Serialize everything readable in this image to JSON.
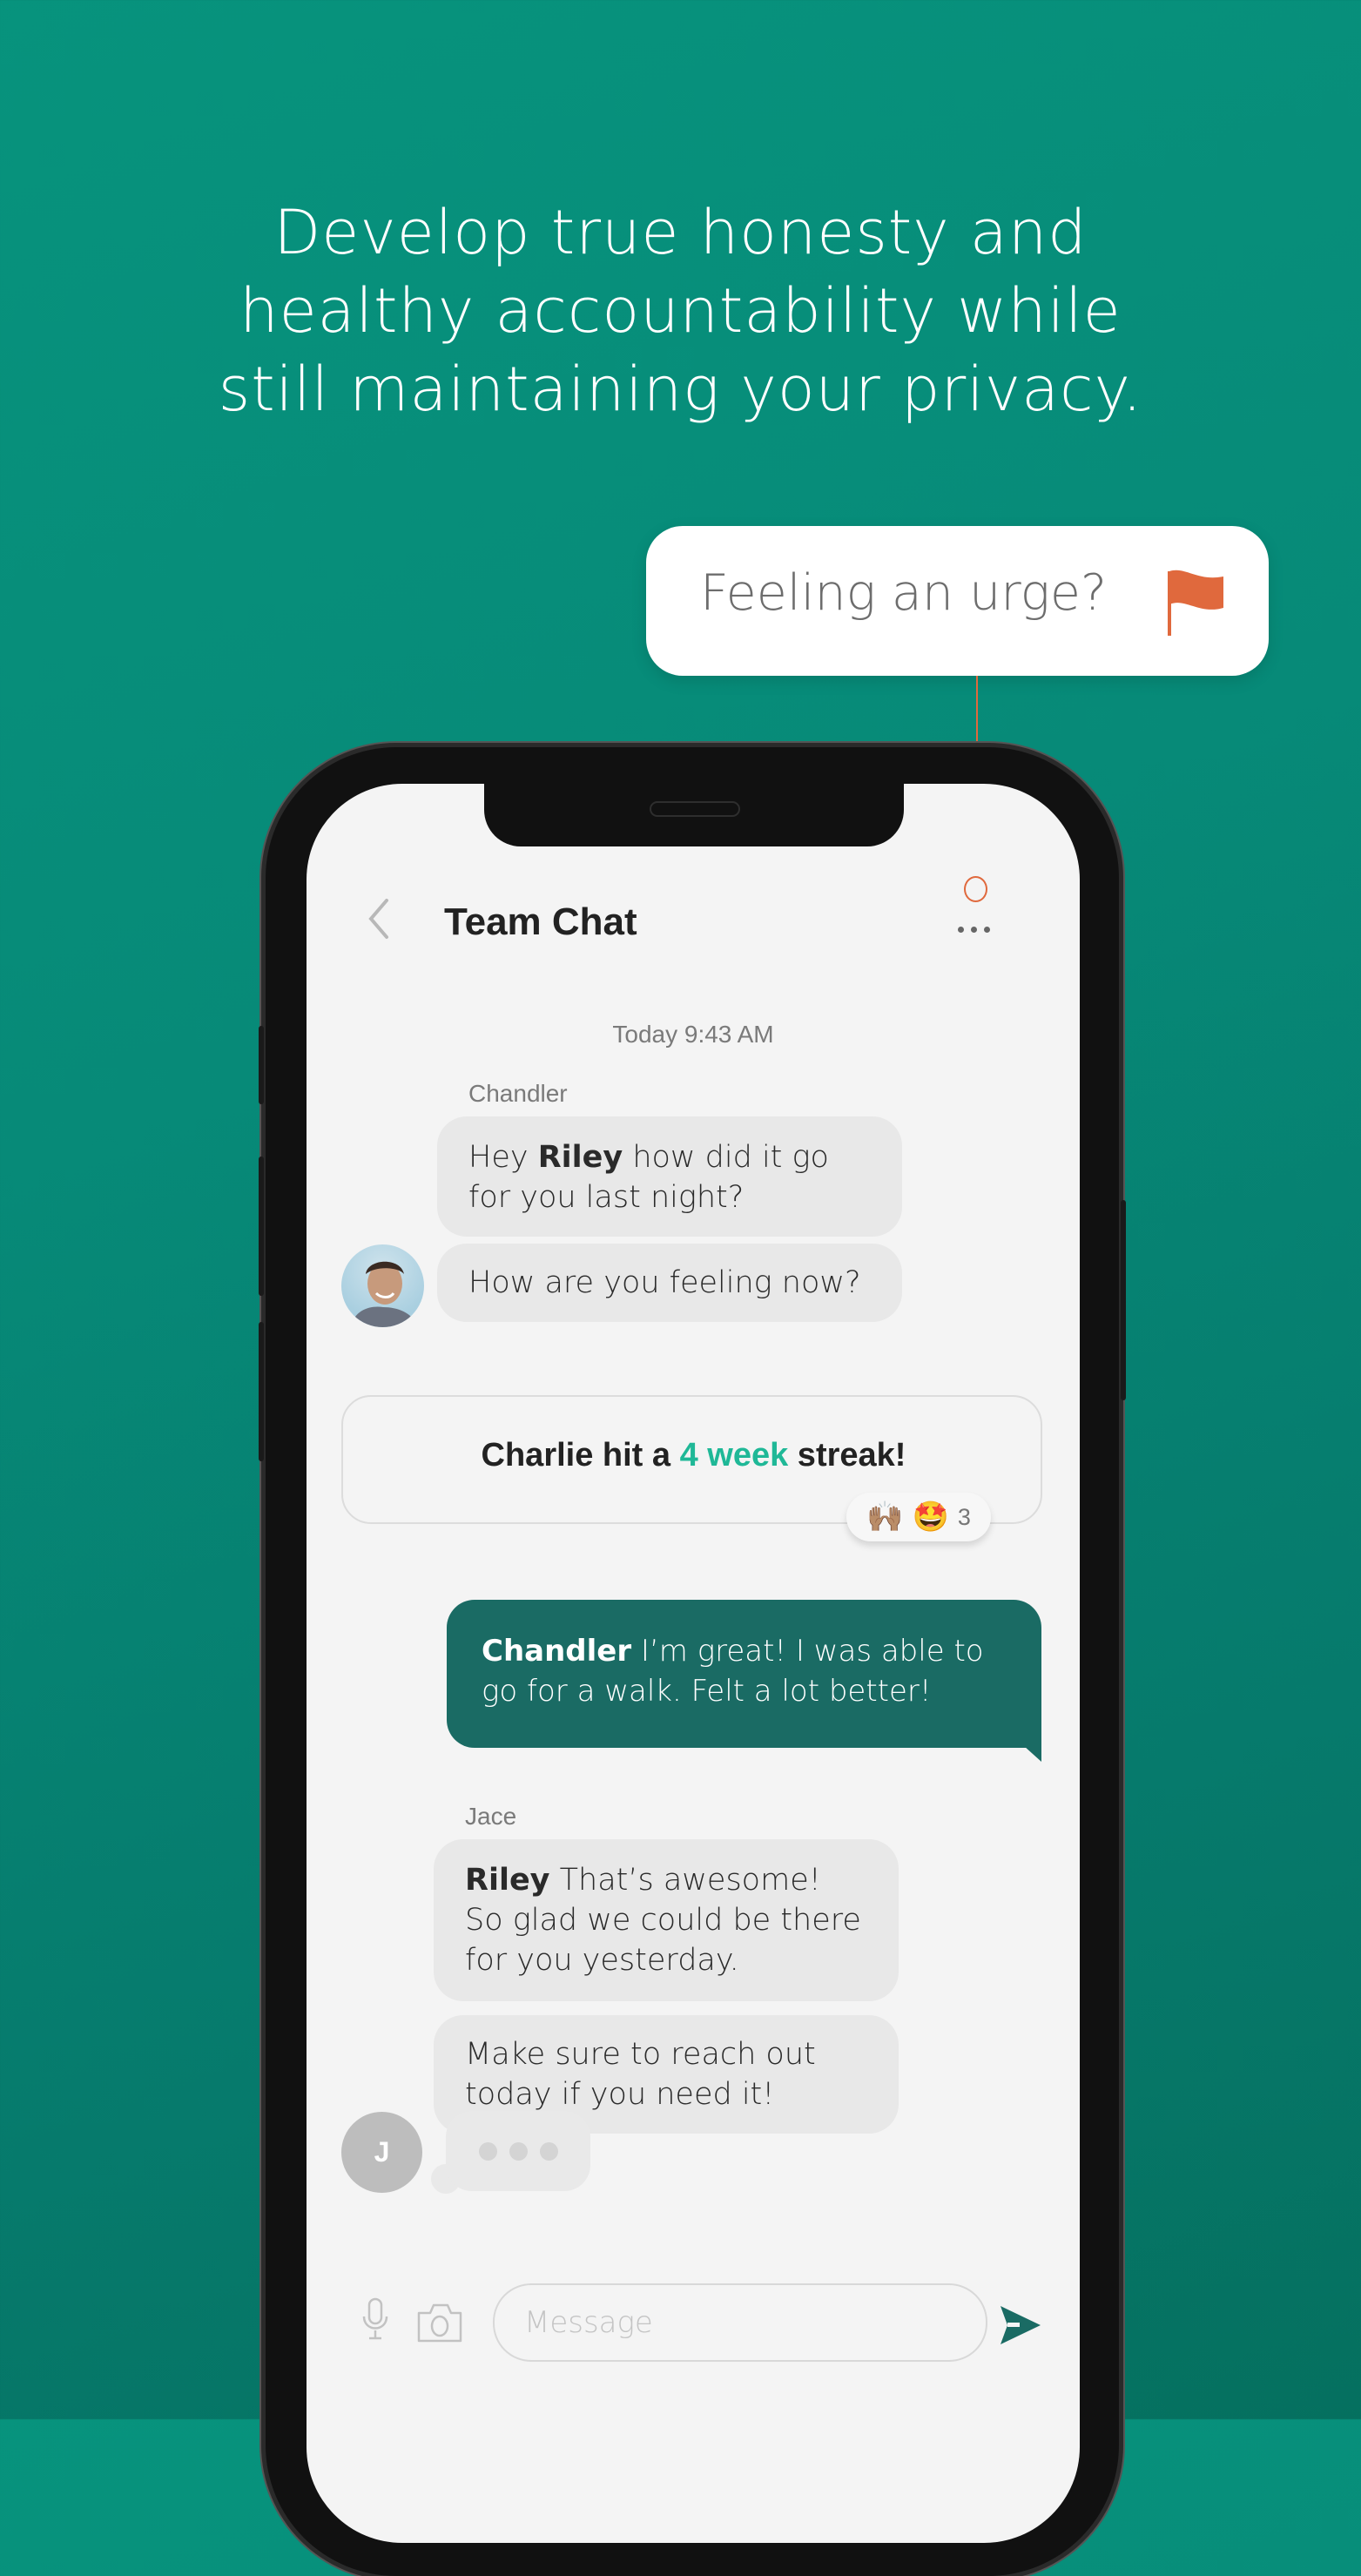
{
  "headline": {
    "lines": [
      "Develop true honesty and",
      "healthy accountability while",
      "still maintaining your privacy."
    ]
  },
  "urge_callout": {
    "label": "Feeling an urge?",
    "icon": "flag-icon",
    "accent_color": "#e0693d"
  },
  "chat": {
    "title": "Team Chat",
    "back_icon": "chevron-left-icon",
    "more_icon": "more-horizontal-icon",
    "timestamp": "Today 9:43 AM",
    "groups": [
      {
        "sender": "Chandler",
        "avatar": "photo",
        "messages": [
          {
            "mention": "Riley",
            "prefix": "Hey ",
            "text": " how did it go for you last night?"
          },
          {
            "text": "How are you feeling now?"
          }
        ]
      }
    ],
    "streak": {
      "prefix": "Charlie hit a ",
      "highlight": "4 week",
      "suffix": " streak!",
      "highlight_color": "#1fb897",
      "reactions": [
        "🙌🏽",
        "🤩"
      ],
      "reaction_count": "3"
    },
    "sent_message": {
      "mention": "Chandler",
      "text": " I’m great! I was able to go for a walk. Felt a lot better!",
      "bubble_color": "#1a6b64"
    },
    "jace_group": {
      "sender": "Jace",
      "messages": [
        {
          "mention": "Riley",
          "text": " That’s awesome! So glad we could be there for you yesterday."
        },
        {
          "text": "Make sure to reach out today if you need it!"
        }
      ],
      "avatar_initial": "J",
      "typing": true
    },
    "composer": {
      "placeholder": "Message",
      "mic_icon": "microphone-icon",
      "camera_icon": "camera-icon",
      "send_icon": "send-icon",
      "send_color": "#1a6b64"
    }
  }
}
